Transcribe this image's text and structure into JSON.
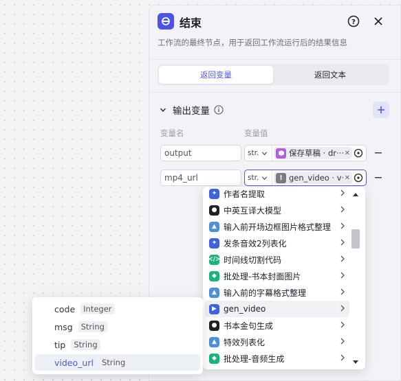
{
  "panel": {
    "title": "结束",
    "description": "工作流的最终节点，用于返回工作流运行后的结果信息",
    "tabs": [
      {
        "label": "返回变量",
        "active": true
      },
      {
        "label": "返回文本",
        "active": false
      }
    ],
    "output_section": {
      "title": "输出变量",
      "col_name": "变量名",
      "col_value": "变量值"
    },
    "rows": [
      {
        "name": "output",
        "type": "str.",
        "ref_text": "保存草稿 · dr···",
        "ref_icon_color": "#b45be8"
      },
      {
        "name": "mp4_url",
        "type": "str.",
        "ref_text": "gen_video · v···",
        "ref_icon_color": "#7a7b85"
      }
    ]
  },
  "dropdown": {
    "items": [
      {
        "label": "作者名提取",
        "icon": "plugin-icon",
        "color": "#3e63dd"
      },
      {
        "label": "中英互译大模型",
        "icon": "robot-icon",
        "color": "#1f1f24"
      },
      {
        "label": "输入前开场边框图片格式整理",
        "icon": "image-icon",
        "color": "#4a90d9"
      },
      {
        "label": "发条音效2列表化",
        "icon": "plugin-icon",
        "color": "#3e63dd"
      },
      {
        "label": "时间线切割代码",
        "icon": "code-icon",
        "color": "#19b37e"
      },
      {
        "label": "批处理-书本封面图片",
        "icon": "batch-icon",
        "color": "#19b37e"
      },
      {
        "label": "输入前的字幕格式整理",
        "icon": "image-icon",
        "color": "#4a90d9"
      },
      {
        "label": "gen_video",
        "icon": "play-icon",
        "color": "#3e63dd"
      },
      {
        "label": "书本金句生成",
        "icon": "robot-icon",
        "color": "#1f1f24"
      },
      {
        "label": "特效列表化",
        "icon": "image-icon",
        "color": "#4a90d9"
      },
      {
        "label": "批处理-音频生成",
        "icon": "batch-icon",
        "color": "#19b37e"
      }
    ],
    "highlighted": "gen_video"
  },
  "subpanel": {
    "fields": [
      {
        "name": "code",
        "type": "Integer"
      },
      {
        "name": "msg",
        "type": "String"
      },
      {
        "name": "tip",
        "type": "String"
      },
      {
        "name": "video_url",
        "type": "String"
      }
    ],
    "selected": "video_url"
  },
  "colors": {
    "accent": "#4d53e8",
    "panel_bg": "#f3f3f7"
  }
}
